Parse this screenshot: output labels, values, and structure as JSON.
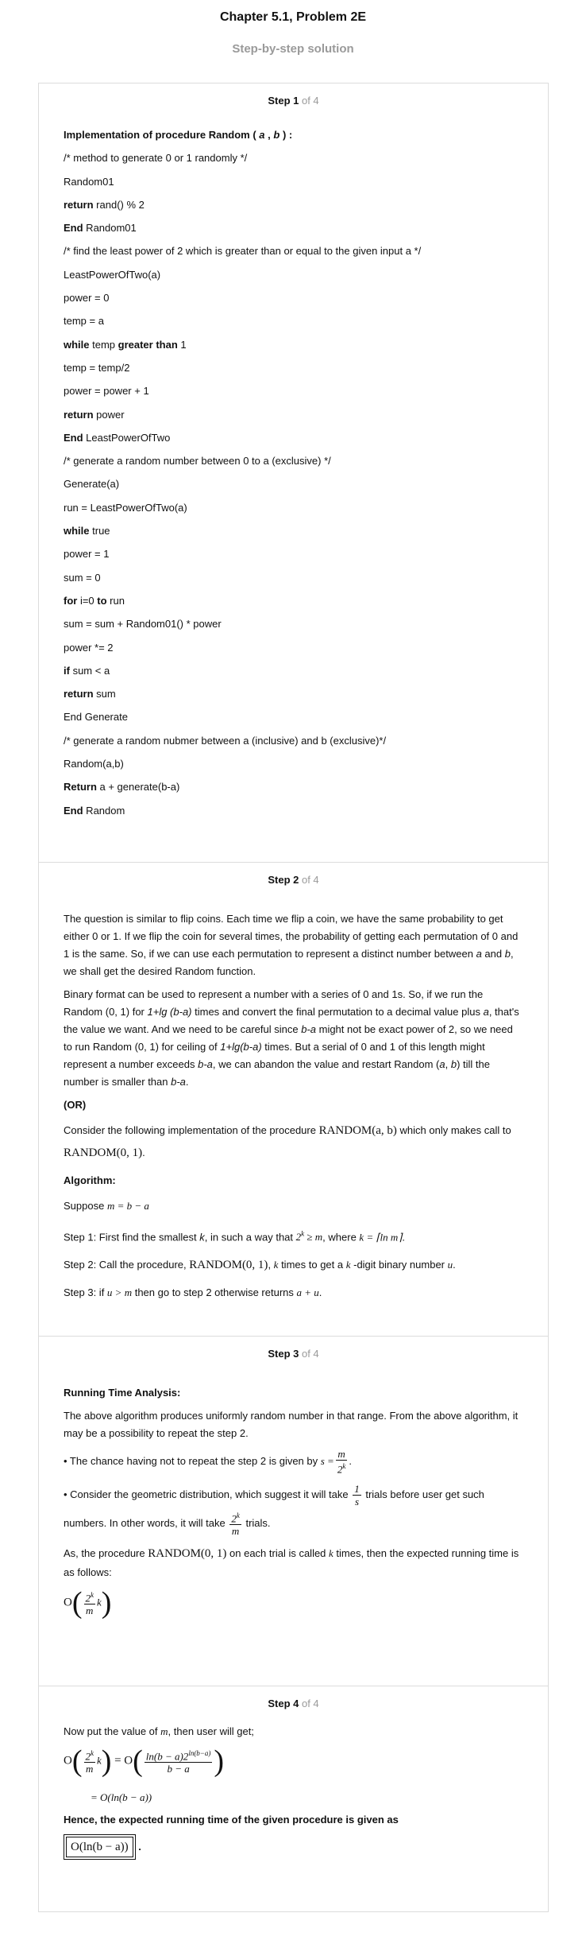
{
  "header": {
    "title": "Chapter 5.1, Problem 2E",
    "subtitle": "Step-by-step solution"
  },
  "steps": [
    {
      "label": "Step 1",
      "of": " of 4"
    },
    {
      "label": "Step 2",
      "of": " of 4"
    },
    {
      "label": "Step 3",
      "of": " of 4"
    },
    {
      "label": "Step 4",
      "of": " of 4"
    }
  ],
  "step1": {
    "code": [
      [
        {
          "t": "Implementation of procedure Random ( ",
          "b": true
        },
        {
          "t": "a",
          "b": true,
          "i": true
        },
        {
          "t": " , ",
          "b": true
        },
        {
          "t": "b",
          "b": true,
          "i": true
        },
        {
          "t": " ) :",
          "b": true
        }
      ],
      [
        {
          "t": "/* method to generate 0 or 1 randomly */"
        }
      ],
      [
        {
          "t": "Random01"
        }
      ],
      [
        {
          "t": "return",
          "b": true
        },
        {
          "t": " rand() % 2"
        }
      ],
      [
        {
          "t": "End",
          "b": true
        },
        {
          "t": " Random01"
        }
      ],
      [
        {
          "t": "/* find the least power of 2 which is greater than or equal to the given input a */"
        }
      ],
      [
        {
          "t": "LeastPowerOfTwo(a)"
        }
      ],
      [
        {
          "t": "power = 0"
        }
      ],
      [
        {
          "t": "temp = a"
        }
      ],
      [
        {
          "t": "while",
          "b": true
        },
        {
          "t": " temp "
        },
        {
          "t": "greater than",
          "b": true
        },
        {
          "t": " 1"
        }
      ],
      [
        {
          "t": "temp = temp/2"
        }
      ],
      [
        {
          "t": "power = power + 1"
        }
      ],
      [
        {
          "t": "return",
          "b": true
        },
        {
          "t": " power"
        }
      ],
      [
        {
          "t": "End",
          "b": true
        },
        {
          "t": " LeastPowerOfTwo"
        }
      ],
      [
        {
          "t": "/* generate a random number between 0 to a (exclusive) */"
        }
      ],
      [
        {
          "t": "Generate(a)"
        }
      ],
      [
        {
          "t": "run = LeastPowerOfTwo(a)"
        }
      ],
      [
        {
          "t": "while",
          "b": true
        },
        {
          "t": " true"
        }
      ],
      [
        {
          "t": "power = 1"
        }
      ],
      [
        {
          "t": "sum = 0"
        }
      ],
      [
        {
          "t": "for",
          "b": true
        },
        {
          "t": " i=0 "
        },
        {
          "t": "to",
          "b": true
        },
        {
          "t": " run"
        }
      ],
      [
        {
          "t": "sum = sum + Random01() * power"
        }
      ],
      [
        {
          "t": "power *= 2"
        }
      ],
      [
        {
          "t": "if",
          "b": true
        },
        {
          "t": " sum < a"
        }
      ],
      [
        {
          "t": "return",
          "b": true
        },
        {
          "t": " sum"
        }
      ],
      [
        {
          "t": "End Generate"
        }
      ],
      [
        {
          "t": "/* generate a random nubmer between a (inclusive) and b (exclusive)*/"
        }
      ],
      [
        {
          "t": "Random(a,b)"
        }
      ],
      [
        {
          "t": "Return",
          "b": true
        },
        {
          "t": " a + generate(b-a)"
        }
      ],
      [
        {
          "t": "End",
          "b": true
        },
        {
          "t": " Random"
        }
      ]
    ]
  },
  "step2": {
    "p1a": "The question is similar to flip coins. Each time we flip a coin, we have the same probability to get either 0 or 1. If we flip the coin for several times, the probability of getting each permutation of 0 and 1 is the same. So, if we can use each permutation to represent a distinct number between ",
    "p1a_i": "a",
    "p1b": " and ",
    "p1b_i": "b",
    "p1c": ", we shall get the desired Random function.",
    "p2a": "Binary format can be used to represent a number with a series of 0 and 1s. So, if we run the Random (0, 1) for ",
    "p2a_i": "1+lg (b-a)",
    "p2b": " times and convert the final permutation to a decimal value plus ",
    "p2b_i": "a",
    "p2c": ", that's the value we want. And we need to be careful since ",
    "p2c_i": "b-a",
    "p2d": " might not be exact power of 2, so we need to run Random (0, 1) for ceiling of ",
    "p2d_i": "1+lg(b-a)",
    "p2e": " times. But a serial of 0 and 1 of this length might represent a number exceeds ",
    "p2e_i": "b-a",
    "p2f": ", we can abandon the value and restart Random (",
    "p2f_i1": "a",
    "p2f_sep": ", ",
    "p2f_i2": "b",
    "p2g": ") till the number is smaller than ",
    "p2g_i": "b-a",
    "p2h": ".",
    "or": "(OR)",
    "consider1": "Consider the following implementation of the procedure ",
    "consider_fn": "RANDOM(a, b)",
    "consider2": " which only makes call to ",
    "consider_fn2": "RANDOM(0, 1)",
    "consider3": ".",
    "algorithm_label": "Algorithm:",
    "suppose": "Suppose ",
    "suppose_math": "m = b − a",
    "s1a": "Step 1: First find the smallest ",
    "s1a_i": "k",
    "s1b": ", in such a way that ",
    "s1_math1": "2",
    "s1_math1_sup": "k",
    "s1_math1_rest": " ≥ m",
    "s1c": ", where ",
    "s1_math2": "k = ⌈ln m⌉",
    "s1d": ".",
    "s2a": "Step 2: Call the procedure, ",
    "s2_fn": "RANDOM(0, 1)",
    "s2_sep": ", ",
    "s2_k": "k",
    "s2b": " times to get a ",
    "s2_k2": "k",
    "s2c": " -digit binary number ",
    "s2_u": "u",
    "s2d": ".",
    "s3a": "Step 3: if ",
    "s3_math": "u > m",
    "s3b": " then go to step 2 otherwise returns ",
    "s3_math2": "a + u",
    "s3c": "."
  },
  "step3": {
    "heading": "Running Time Analysis:",
    "p1": "The above algorithm produces uniformly random number in that range. From the above algorithm, it may be a possibility to repeat the step 2.",
    "b1a": "• The chance having not to repeat the step 2 is given by ",
    "b1_lhs": "s =",
    "b1_num": "m",
    "b1_den": "2",
    "b1_den_sup": "k",
    "b1b": ".",
    "b2a": "• Consider the geometric distribution, which suggest it will take ",
    "b2_num": "1",
    "b2_den": "s",
    "b2b": " trials before user get such",
    "b3a": "numbers. In other words, it will take ",
    "b3_num": "2",
    "b3_num_sup": "k",
    "b3_den": "m",
    "b3b": " trials.",
    "p2a": "As, the procedure ",
    "p2_fn": "RANDOM(0, 1)",
    "p2b": " on each trial is called ",
    "p2_k": "k",
    "p2c": " times, then the expected running time is as follows:",
    "result_O": "O",
    "result_num": "2",
    "result_num_sup": "k",
    "result_den": "m",
    "result_k": "k"
  },
  "step4": {
    "p1a": "Now put the value of ",
    "p1_m": "m",
    "p1b": ", then user will get;",
    "eq1_O": "O",
    "eq1_num": "2",
    "eq1_num_sup": "k",
    "eq1_den": "m",
    "eq1_k": "k",
    "eq1_eq": "= O",
    "eq1_rnum": "ln(b − a)2",
    "eq1_rnum_sup": "ln(b−a)",
    "eq1_rden": "b − a",
    "eq2": "= O(ln(b − a))",
    "conclusion": "Hence, the expected running time of the given procedure is given as",
    "boxed": "O(ln(b − a))",
    "period": "."
  }
}
